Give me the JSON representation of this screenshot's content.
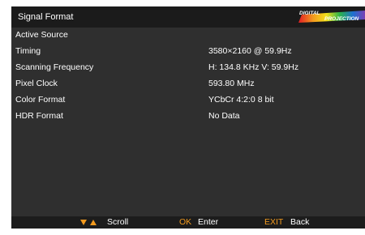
{
  "header": {
    "title": "Signal Format",
    "logo_text_top": "DIGITAL",
    "logo_text_bottom": "PROJECTION"
  },
  "rows": [
    {
      "label": "Active Source",
      "value": ""
    },
    {
      "label": "Timing",
      "value": "3580×2160 @ 59.9Hz"
    },
    {
      "label": "Scanning Frequency",
      "value": "H: 134.8 KHz V: 59.9Hz"
    },
    {
      "label": "Pixel Clock",
      "value": "593.80 MHz"
    },
    {
      "label": "Color Format",
      "value": "YCbCr 4:2:0 8 bit"
    },
    {
      "label": "HDR Format",
      "value": "No Data"
    }
  ],
  "footer": {
    "scroll_label": "Scroll",
    "ok_key": "OK",
    "ok_label": "Enter",
    "exit_key": "EXIT",
    "exit_label": "Back"
  },
  "colors": {
    "accent": "#f39a1e",
    "panel": "#2f2f2f",
    "header": "#1b1b1b",
    "footer": "#1c1c1c",
    "text": "#ffffff"
  },
  "icons": {
    "scroll": "up-down-arrows-icon",
    "logo": "digital-projection-logo"
  }
}
